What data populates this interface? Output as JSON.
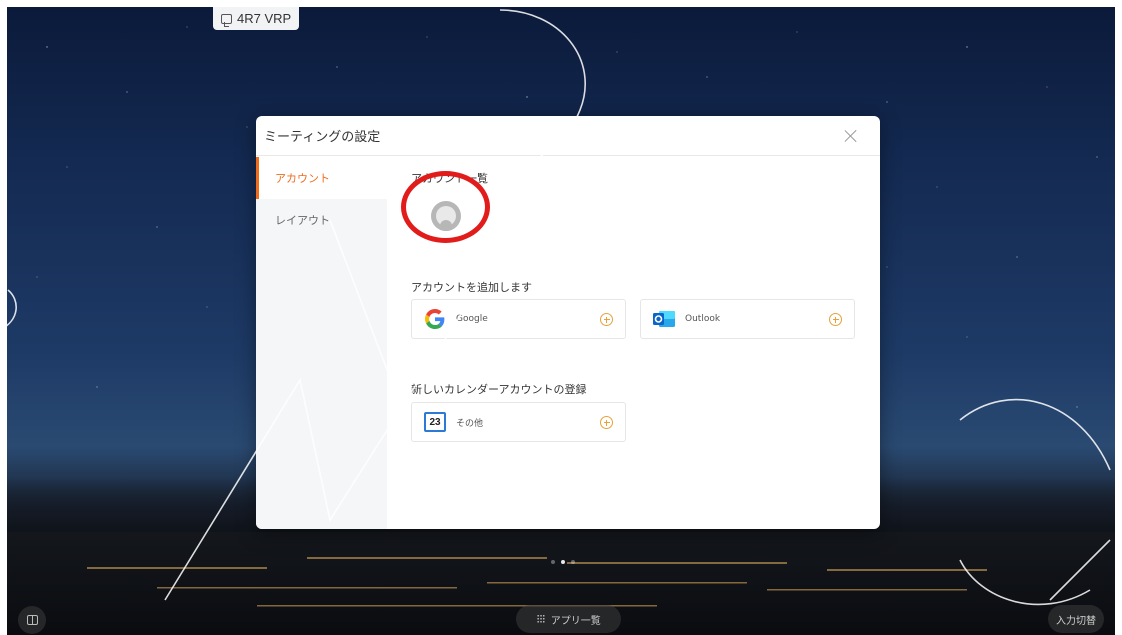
{
  "room_chip": {
    "label": "4R7 VRP",
    "icon": "screen-share-icon"
  },
  "dialog": {
    "title": "ミーティングの設定",
    "close_icon": "close-icon",
    "sidebar": [
      {
        "label": "アカウント",
        "active": true
      },
      {
        "label": "レイアウト",
        "active": false
      }
    ],
    "account_list_title": "アカウント一覧",
    "add_account_title": "アカウントを追加します",
    "providers": [
      {
        "label": "Google",
        "icon": "google-icon"
      },
      {
        "label": "Outlook",
        "icon": "outlook-icon"
      }
    ],
    "new_calendar_title": "新しいカレンダーアカウントの登録",
    "other": {
      "label": "その他",
      "icon_text": "23",
      "icon": "calendar-icon"
    }
  },
  "bottom": {
    "app_list": "アプリ一覧",
    "input_switch": "入力切替"
  },
  "colors": {
    "accent": "#ef6c1d",
    "plus": "#e8a13a",
    "annotation_circle": "#e21b1b"
  }
}
